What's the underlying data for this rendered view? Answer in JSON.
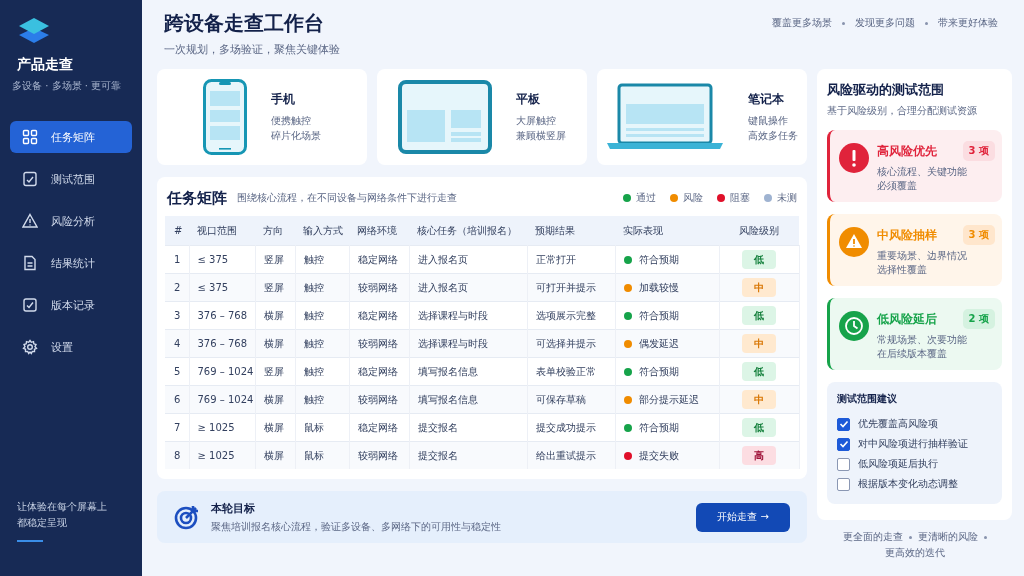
{
  "sidebar": {
    "brand": "产品走查",
    "tagline": "多设备 · 多场景 · 更可靠",
    "items": [
      {
        "label": "任务矩阵",
        "selected": true
      },
      {
        "label": "测试范围",
        "selected": false
      },
      {
        "label": "风险分析",
        "selected": false
      },
      {
        "label": "结果统计",
        "selected": false
      },
      {
        "label": "版本记录",
        "selected": false
      },
      {
        "label": "设置",
        "selected": false
      }
    ],
    "footer": [
      "让体验在每个屏幕上",
      "都稳定呈现"
    ]
  },
  "header": {
    "title": "跨设备走查工作台",
    "subtitle": "一次规划，多场验证，聚焦关键体验",
    "slogans": [
      "覆盖更多场景",
      "发现更多问题",
      "带来更好体验"
    ]
  },
  "devices": [
    {
      "kind": "phone",
      "name": "手机",
      "lines": [
        "便携触控",
        "碎片化场景"
      ]
    },
    {
      "kind": "tablet",
      "name": "平板",
      "lines": [
        "大屏触控",
        "兼顾横竖屏"
      ]
    },
    {
      "kind": "laptop",
      "name": "笔记本",
      "lines": [
        "键鼠操作",
        "高效多任务"
      ]
    }
  ],
  "matrix": {
    "title": "任务矩阵",
    "subtitle": "围绕核心流程，在不同设备与网络条件下进行走查",
    "legend": [
      {
        "label": "通过",
        "color": "#16a34a"
      },
      {
        "label": "风险",
        "color": "#f08c00"
      },
      {
        "label": "阻塞",
        "color": "#e0102a"
      },
      {
        "label": "未测",
        "color": "#9fb3d1"
      }
    ],
    "columns": [
      "#",
      "视口范围",
      "方向",
      "输入方式",
      "网络环境",
      "核心任务（培训报名）",
      "预期结果",
      "实际表现",
      "风险级别"
    ],
    "rows": [
      {
        "cells": [
          "1",
          "≤ 375",
          "竖屏",
          "触控",
          "稳定网络",
          "进入报名页",
          "正常打开"
        ],
        "result": {
          "text": "符合预期",
          "color": "#16a34a"
        },
        "risk": {
          "text": "低",
          "kind": "low"
        }
      },
      {
        "cells": [
          "2",
          "≤ 375",
          "竖屏",
          "触控",
          "较弱网络",
          "进入报名页",
          "可打开并提示"
        ],
        "result": {
          "text": "加载较慢",
          "color": "#f08c00"
        },
        "risk": {
          "text": "中",
          "kind": "mid"
        }
      },
      {
        "cells": [
          "3",
          "376 – 768",
          "横屏",
          "触控",
          "稳定网络",
          "选择课程与时段",
          "选项展示完整"
        ],
        "result": {
          "text": "符合预期",
          "color": "#16a34a"
        },
        "risk": {
          "text": "低",
          "kind": "low"
        }
      },
      {
        "cells": [
          "4",
          "376 – 768",
          "横屏",
          "触控",
          "较弱网络",
          "选择课程与时段",
          "可选择并提示"
        ],
        "result": {
          "text": "偶发延迟",
          "color": "#f08c00"
        },
        "risk": {
          "text": "中",
          "kind": "mid"
        }
      },
      {
        "cells": [
          "5",
          "769 – 1024",
          "竖屏",
          "触控",
          "稳定网络",
          "填写报名信息",
          "表单校验正常"
        ],
        "result": {
          "text": "符合预期",
          "color": "#16a34a"
        },
        "risk": {
          "text": "低",
          "kind": "low"
        }
      },
      {
        "cells": [
          "6",
          "769 – 1024",
          "横屏",
          "触控",
          "较弱网络",
          "填写报名信息",
          "可保存草稿"
        ],
        "result": {
          "text": "部分提示延迟",
          "color": "#f08c00"
        },
        "risk": {
          "text": "中",
          "kind": "mid"
        }
      },
      {
        "cells": [
          "7",
          "≥ 1025",
          "横屏",
          "鼠标",
          "稳定网络",
          "提交报名",
          "提交成功提示"
        ],
        "result": {
          "text": "符合预期",
          "color": "#16a34a"
        },
        "risk": {
          "text": "低",
          "kind": "low"
        }
      },
      {
        "cells": [
          "8",
          "≥ 1025",
          "横屏",
          "鼠标",
          "较弱网络",
          "提交报名",
          "给出重试提示"
        ],
        "result": {
          "text": "提交失败",
          "color": "#e0102a"
        },
        "risk": {
          "text": "高",
          "kind": "high"
        }
      }
    ]
  },
  "goal": {
    "title": "本轮目标",
    "text": "聚焦培训报名核心流程，验证多设备、多网络下的可用性与稳定性",
    "button": "开始走查 →"
  },
  "scope": {
    "title": "风险驱动的测试范围",
    "subtitle": "基于风险级别，合理分配测试资源",
    "cards": [
      {
        "kind": "high",
        "title": "高风险优先",
        "count": "3 项",
        "lines": [
          "核心流程、关键功能",
          "必须覆盖"
        ]
      },
      {
        "kind": "mid",
        "title": "中风险抽样",
        "count": "3 项",
        "lines": [
          "重要场景、边界情况",
          "选择性覆盖"
        ]
      },
      {
        "kind": "low",
        "title": "低风险延后",
        "count": "2 项",
        "lines": [
          "常规场景、次要功能",
          "在后续版本覆盖"
        ]
      }
    ],
    "advice": {
      "title": "测试范围建议",
      "items": [
        {
          "label": "优先覆盖高风险项",
          "checked": true
        },
        {
          "label": "对中风险项进行抽样验证",
          "checked": true
        },
        {
          "label": "低风险项延后执行",
          "checked": false
        },
        {
          "label": "根据版本变化动态调整",
          "checked": false
        }
      ]
    }
  },
  "footer": [
    "更全面的走查",
    "更清晰的风险",
    "更高效的迭代"
  ]
}
